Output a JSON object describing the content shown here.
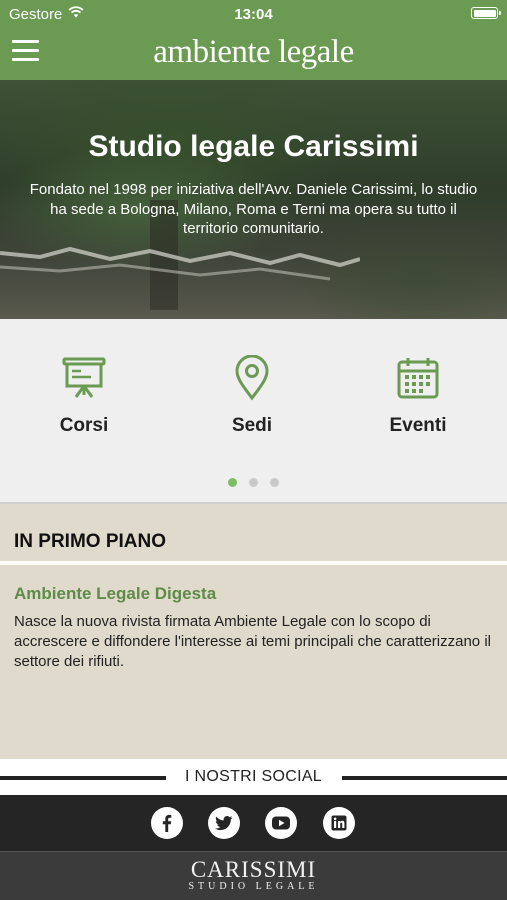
{
  "status_bar": {
    "carrier": "Gestore",
    "time": "13:04"
  },
  "header": {
    "brand": "ambiente legale"
  },
  "hero": {
    "title": "Studio legale Carissimi",
    "description": "Fondato nel 1998 per iniziativa dell'Avv. Daniele Carissimi, lo studio ha sede a Bologna, Milano, Roma e Terni ma opera su tutto il territorio comunitario."
  },
  "features": {
    "items": [
      {
        "label": "Corsi",
        "icon": "presentation-board-icon"
      },
      {
        "label": "Sedi",
        "icon": "location-pin-icon"
      },
      {
        "label": "Eventi",
        "icon": "calendar-icon"
      }
    ],
    "page_indicator": {
      "count": 3,
      "active": 1
    }
  },
  "news": {
    "section_title": "IN PRIMO PIANO",
    "headline": "Ambiente Legale Digesta",
    "summary": "Nasce la nuova rivista firmata Ambiente Legale con lo scopo di accrescere e diffondere l'interesse ai temi principali che caratterizzano il settore dei rifiuti."
  },
  "social": {
    "title": "I NOSTRI SOCIAL",
    "links": [
      "facebook-icon",
      "twitter-icon",
      "youtube-icon",
      "linkedin-icon"
    ]
  },
  "footer": {
    "brand": "CARISSIMI",
    "tagline": "STUDIO LEGALE"
  },
  "colors": {
    "brand_green": "#6b9a52",
    "accent_green": "#7cbf63",
    "news_bg": "#e0dacd",
    "dark": "#252525"
  }
}
